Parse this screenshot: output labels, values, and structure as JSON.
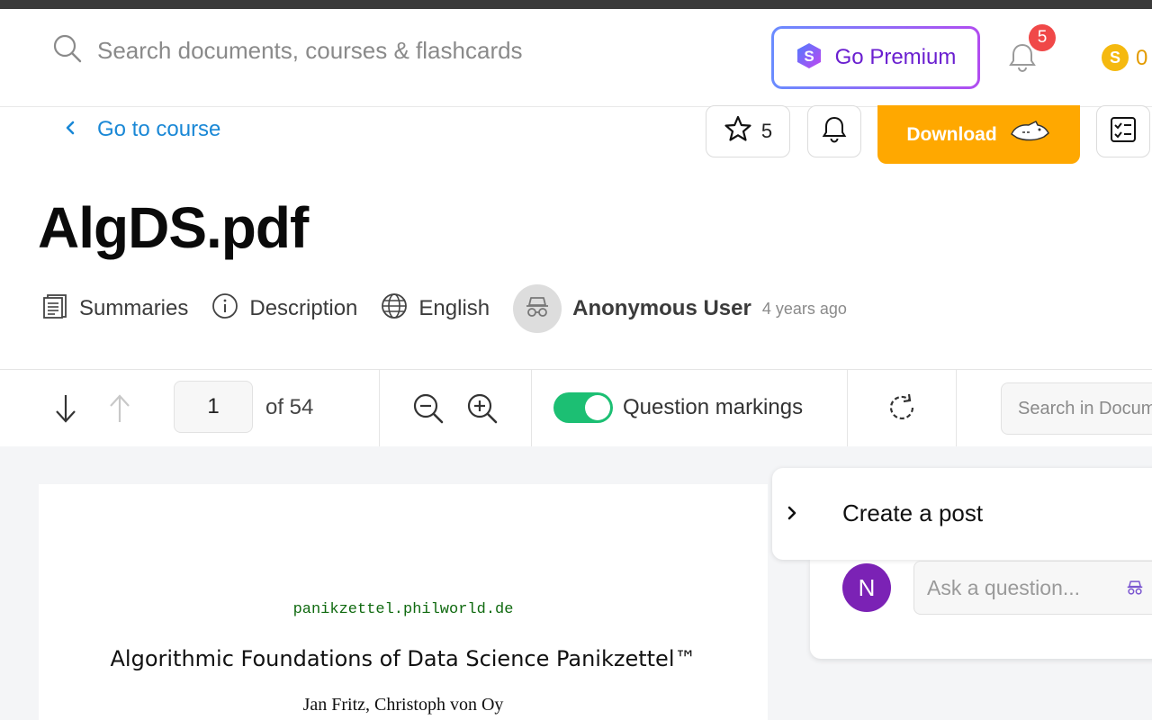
{
  "header": {
    "search_placeholder": "Search documents, courses & flashcards",
    "premium_label": "Go Premium",
    "notification_count": "5",
    "coin_symbol": "S",
    "coin_count": "0"
  },
  "doc_actions": {
    "back_label": "Go to course",
    "rating_count": "5",
    "download_label": "Download"
  },
  "document": {
    "title": "AlgDS.pdf",
    "meta": {
      "category": "Summaries",
      "description": "Description",
      "language": "English",
      "author": "Anonymous User",
      "uploaded": "4 years ago"
    }
  },
  "toolbar": {
    "current_page": "1",
    "of_label": "of  54",
    "question_markings_label": "Question markings",
    "question_markings_on": true,
    "doc_search_placeholder": "Search in Document"
  },
  "pdf": {
    "url": "panikzettel.philworld.de",
    "title": "Algorithmic Foundations of Data Science Panikzettel™",
    "authors": "Jan Fritz, Christoph von Oy"
  },
  "post_panel": {
    "title": "Create a post",
    "avatar_letter": "N",
    "ask_placeholder": "Ask a question..."
  },
  "colors": {
    "accent_blue": "#1a88d6",
    "download": "#ffa800",
    "toggle_on": "#1cbf73",
    "premium_text": "#6a1fd0",
    "avatar": "#7b22b5",
    "badge": "#f04848"
  }
}
